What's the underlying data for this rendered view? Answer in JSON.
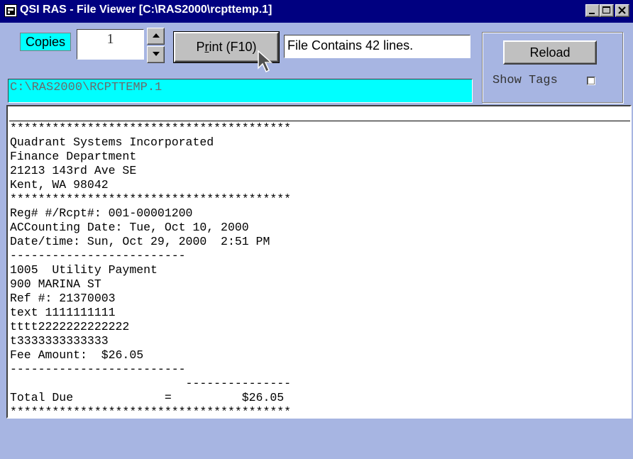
{
  "window": {
    "title": "QSI RAS - File Viewer [C:\\RAS2000\\rcpttemp.1]"
  },
  "controls": {
    "copies_label": "Copies",
    "copies_value": "1",
    "print_label_prefix": "P",
    "print_label_underlined": "r",
    "print_label_suffix": "int (F10)",
    "status_text": "File Contains 42 lines.",
    "file_path": "C:\\RAS2000\\RCPTTEMP.1",
    "reload_label": "Reload",
    "show_tags_label": "Show Tags",
    "show_tags_checked": false
  },
  "file_lines": [
    "****************************************",
    "Quadrant Systems Incorporated",
    "Finance Department",
    "21213 143rd Ave SE",
    "Kent, WA 98042",
    "****************************************",
    "Reg# #/Rcpt#: 001-00001200",
    "ACCounting Date: Tue, Oct 10, 2000",
    "Date/time: Sun, Oct 29, 2000  2:51 PM",
    "-------------------------",
    "1005  Utility Payment",
    "900 MARINA ST",
    "Ref #: 21370003",
    "text 1111111111",
    "tttt2222222222222",
    "t3333333333333",
    "Fee Amount:  $26.05",
    "-------------------------",
    "                         ---------------",
    "Total Due             =          $26.05",
    "****************************************"
  ],
  "icons": {
    "app": "window-icon",
    "minimize": "minimize-icon",
    "maximize": "maximize-icon",
    "close": "close-icon",
    "spin_up": "arrow-up-icon",
    "spin_down": "arrow-down-icon",
    "cursor": "mouse-pointer-icon"
  },
  "colors": {
    "titlebar": "#000080",
    "background": "#a7b5e2",
    "cyan_field": "#00ffff"
  }
}
